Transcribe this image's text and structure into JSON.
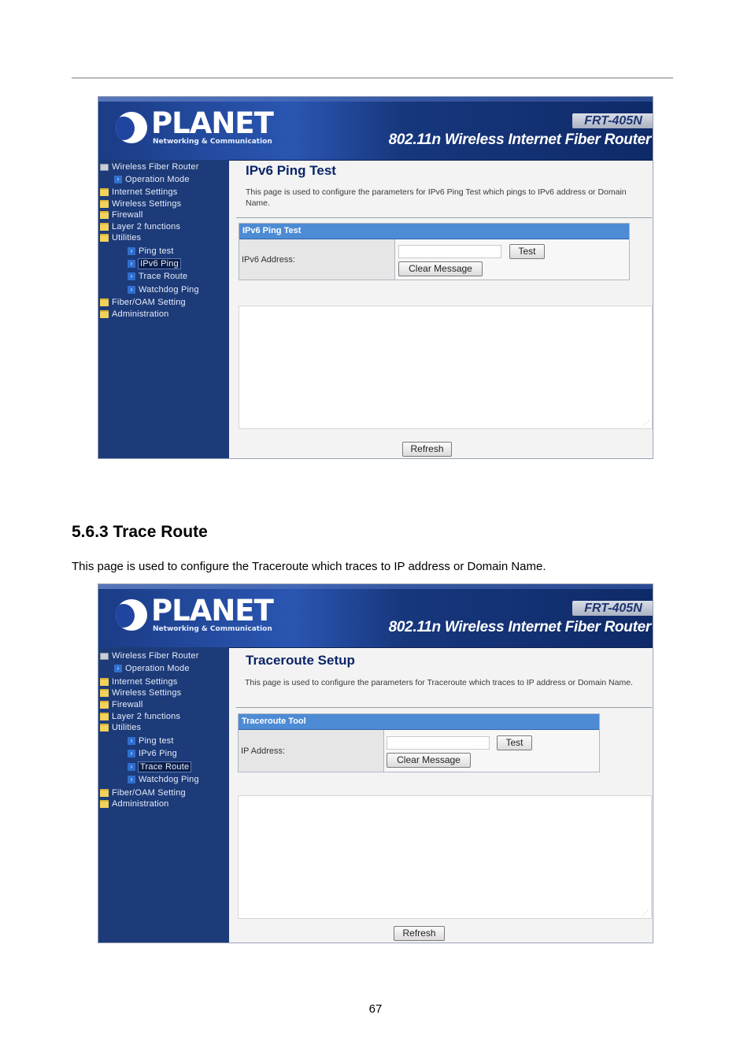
{
  "doc": {
    "section_heading": "5.6.3 Trace Route",
    "section_text": "This page is used to configure the Traceroute which traces to IP address or Domain Name.",
    "page_number": "67"
  },
  "banner": {
    "logo_text": "PLANET",
    "logo_subtitle": "Networking & Communication",
    "model": "FRT-405N",
    "product": "802.11n Wireless Internet Fiber Router"
  },
  "nav": {
    "root": "Wireless Fiber Router",
    "operation_mode": "Operation Mode",
    "internet_settings": "Internet Settings",
    "wireless_settings": "Wireless Settings",
    "firewall": "Firewall",
    "layer2": "Layer 2 functions",
    "utilities": "Utilities",
    "ping_test": "Ping test",
    "ipv6_ping": "IPv6 Ping",
    "trace_route": "Trace Route",
    "watchdog_ping": "Watchdog Ping",
    "fiber_oam": "Fiber/OAM Setting",
    "administration": "Administration"
  },
  "shot1": {
    "title": "IPv6 Ping Test",
    "description": "This page is used to configure the parameters for IPv6 Ping Test which pings to IPv6 address or Domain Name.",
    "tool_header": "IPv6 Ping Test",
    "field_label": "IPv6 Address:",
    "field_value": "",
    "test_button": "Test",
    "clear_button": "Clear Message",
    "refresh_button": "Refresh"
  },
  "shot2": {
    "title": "Traceroute Setup",
    "description": "This page is used to configure the parameters for Traceroute which traces to IP address or Domain Name.",
    "tool_header": "Traceroute Tool",
    "field_label": "IP Address:",
    "field_value": "",
    "test_button": "Test",
    "clear_button": "Clear Message",
    "refresh_button": "Refresh"
  },
  "colors": {
    "banner_blue": "#1b3c86",
    "sidebar_blue": "#1d3b79",
    "tool_header_blue": "#4d8bd4",
    "title_navy": "#0c2568"
  },
  "icons": [
    "folder-icon",
    "arrow-icon",
    "router-icon"
  ]
}
